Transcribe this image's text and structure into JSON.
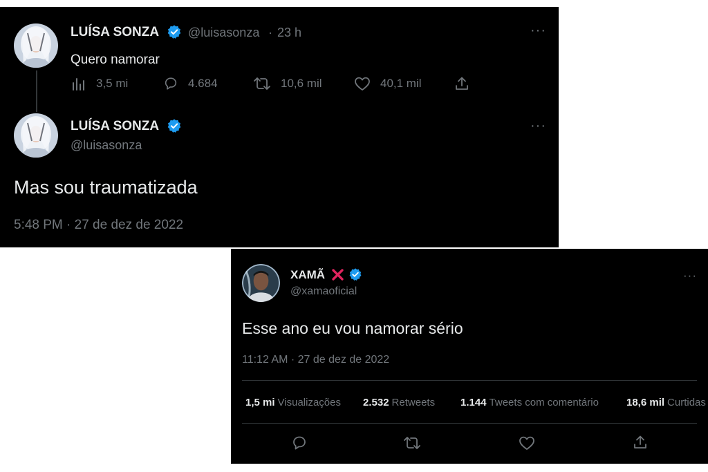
{
  "tweet1": {
    "author_name": "LUÍSA SONZA",
    "author_handle": "@luisasonza",
    "separator": "·",
    "age": "23 h",
    "text": "Quero namorar",
    "views": "3,5 mi",
    "replies": "4.684",
    "retweets": "10,6 mil",
    "likes": "40,1 mil",
    "more_label": "···"
  },
  "tweet2": {
    "author_name": "LUÍSA SONZA",
    "author_handle": "@luisasonza",
    "text": "Mas sou traumatizada",
    "timestamp": "5:48 PM · 27 de dez de 2022",
    "more_label": "···"
  },
  "tweet3": {
    "author_name": "XAMÃ",
    "author_emoji": "❌",
    "author_handle": "@xamaoficial",
    "text": "Esse ano eu vou namorar sério",
    "timestamp": "11:12 AM · 27 de dez de 2022",
    "more_label": "···",
    "stats": {
      "views_num": "1,5 mi",
      "views_label": "Visualizações",
      "retweets_num": "2.532",
      "retweets_label": "Retweets",
      "quotes_num": "1.144",
      "quotes_label": "Tweets com comentário",
      "likes_num": "18,6 mil",
      "likes_label": "Curtidas"
    }
  },
  "icons": {
    "verified": "verified-badge-icon",
    "views": "bar-chart-icon",
    "reply": "reply-icon",
    "retweet": "retweet-icon",
    "like": "heart-icon",
    "share": "share-icon"
  },
  "colors": {
    "background": "#000000",
    "primary_text": "#e7e9ea",
    "secondary_text": "#71767b",
    "verified_blue": "#1d9bf0",
    "cross_red": "#e0245e"
  }
}
